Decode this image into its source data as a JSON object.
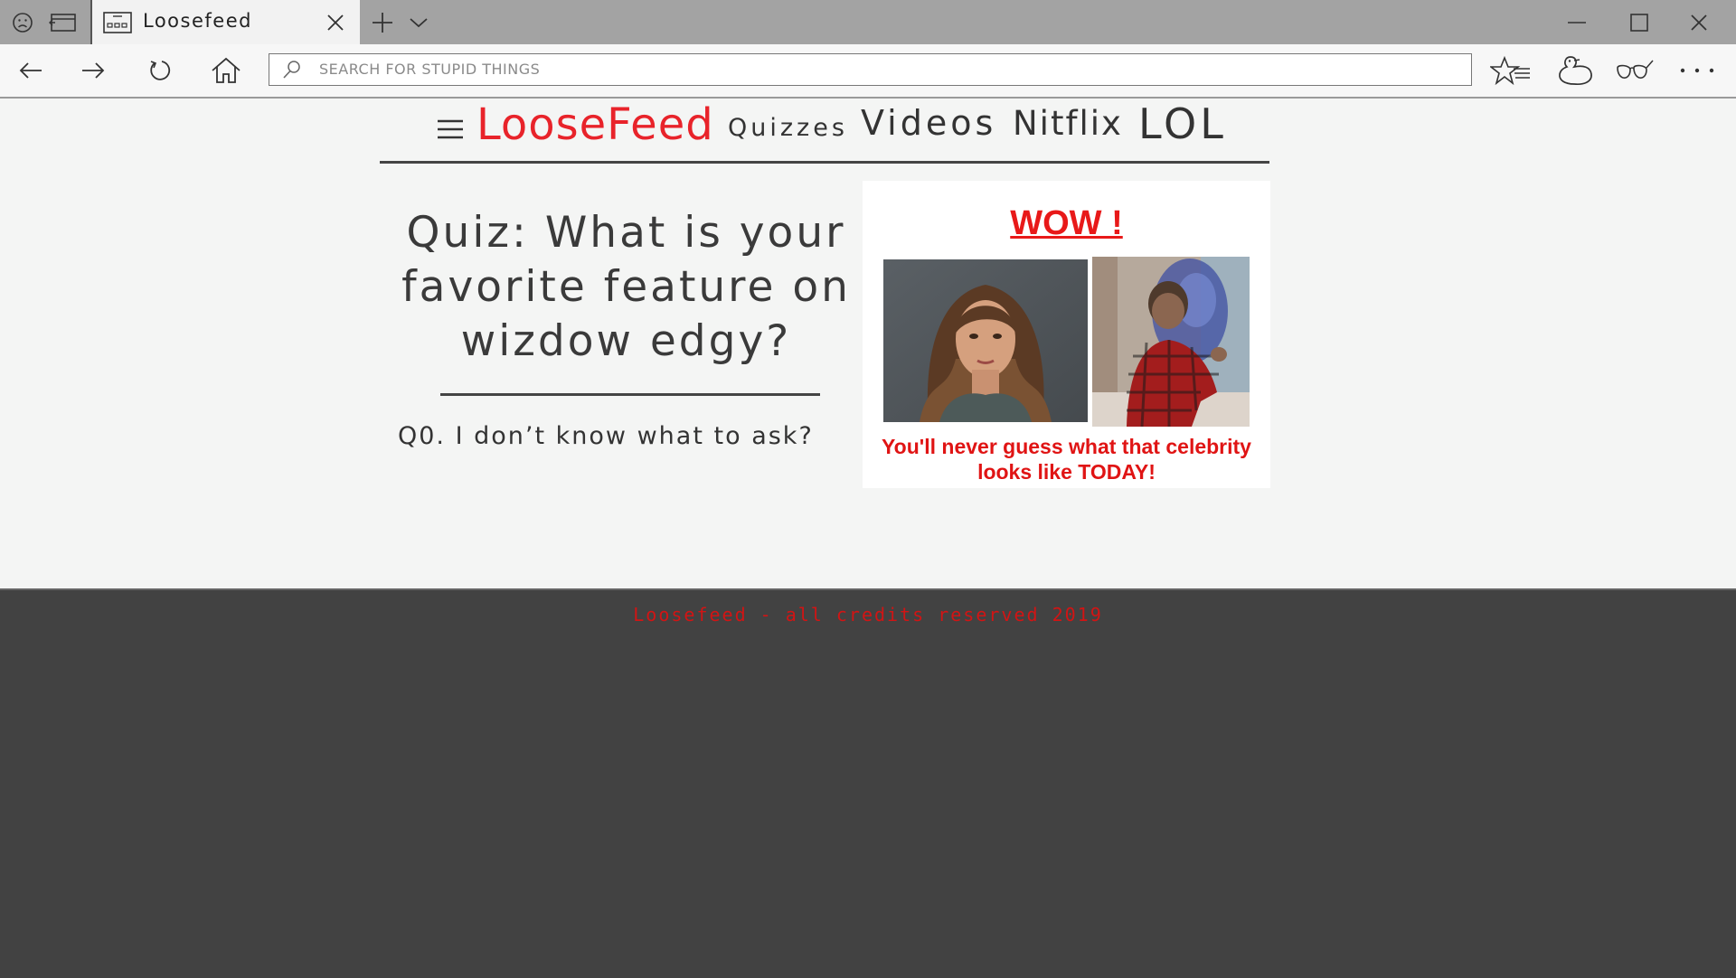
{
  "browser": {
    "tab_title": "Loosefeed",
    "search_placeholder": "SEARCH FOR STUPID THINGS",
    "icons": [
      "sad-face-icon",
      "tab-list-icon",
      "page-icon",
      "close-icon",
      "new-tab-icon",
      "chevron-down-icon",
      "minimize-icon",
      "maximize-icon",
      "window-close-icon",
      "back-icon",
      "forward-icon",
      "refresh-icon",
      "home-icon",
      "search-icon",
      "favorites-icon",
      "duck-icon",
      "glasses-icon",
      "more-icon"
    ]
  },
  "header": {
    "brand": "LooseFeed",
    "nav": [
      "Quizzes",
      "Videos",
      "Nitflix",
      "LOL"
    ]
  },
  "main": {
    "title": "Quiz: What is your favorite feature on wizdow edgy?",
    "question": "Q0. I don’t know what to ask?"
  },
  "ad": {
    "headline": "WOW !",
    "caption": "You'll never guess what that celebrity looks like TODAY!"
  },
  "footer": {
    "text": "Loosefeed - all credits reserved 2019"
  }
}
